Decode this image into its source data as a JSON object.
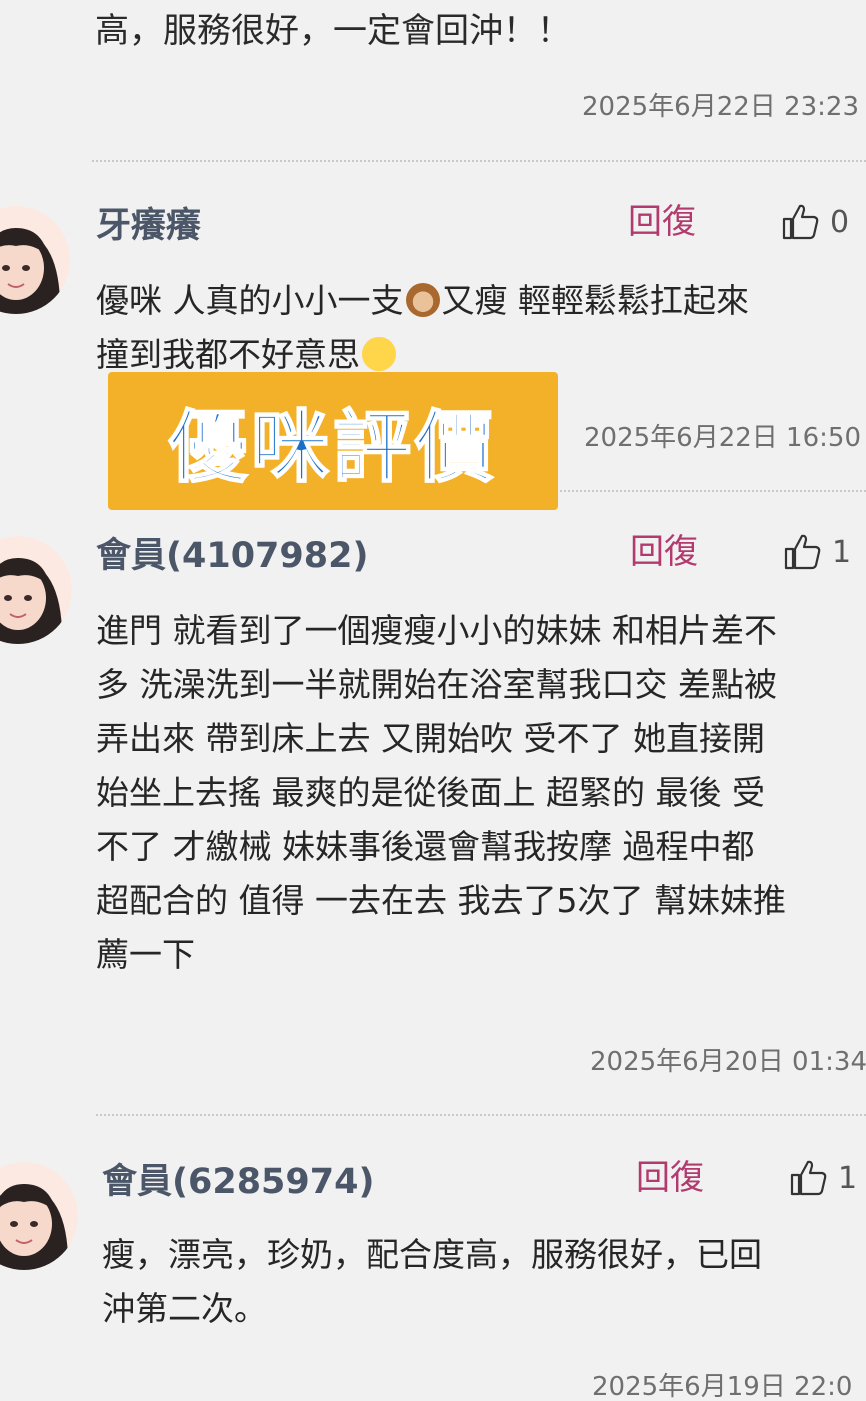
{
  "top_comment": {
    "text_tail": "高，服務很好，一定會回沖！！",
    "timestamp": "2025年6月22日 23:23"
  },
  "comments": [
    {
      "name": "牙癢癢",
      "reply_label": "回復",
      "likes": "0",
      "lines": [
        "優咪 人真的小小一支",
        "又瘦 輕輕鬆鬆扛起來",
        "撞到我都不好意思"
      ],
      "timestamp": "2025年6月22日 16:50"
    },
    {
      "name": "會員(4107982)",
      "reply_label": "回復",
      "likes": "1",
      "lines": [
        "進門 就看到了一個瘦瘦小小的妹妹 和相片差不",
        "多 洗澡洗到一半就開始在浴室幫我口交 差點被",
        "弄出來 帶到床上去 又開始吹 受不了 她直接開",
        "始坐上去搖 最爽的是從後面上 超緊的 最後 受",
        "不了 才繳械 妹妹事後還會幫我按摩 過程中都",
        "超配合的 值得 一去在去 我去了5次了 幫妹妹推",
        "薦一下"
      ],
      "timestamp": "2025年6月20日 01:34"
    },
    {
      "name": "會員(6285974)",
      "reply_label": "回復",
      "likes": "1",
      "lines": [
        "瘦，漂亮，珍奶，配合度高，服務很好，已回",
        "沖第二次。"
      ],
      "timestamp": "2025年6月19日 22:0"
    }
  ],
  "banner": {
    "text": "優咪評價",
    "bg_color": "#f3b12a",
    "text_color": "#1a6fc9"
  },
  "icons": {
    "like": "thumbs-up-icon",
    "emoji_1": "see-no-evil-monkey-emoji",
    "emoji_2": "grinning-sweat-emoji"
  },
  "colors": {
    "reply": "#b23a6e",
    "name": "#4b5768",
    "background": "#f1f1f1"
  }
}
